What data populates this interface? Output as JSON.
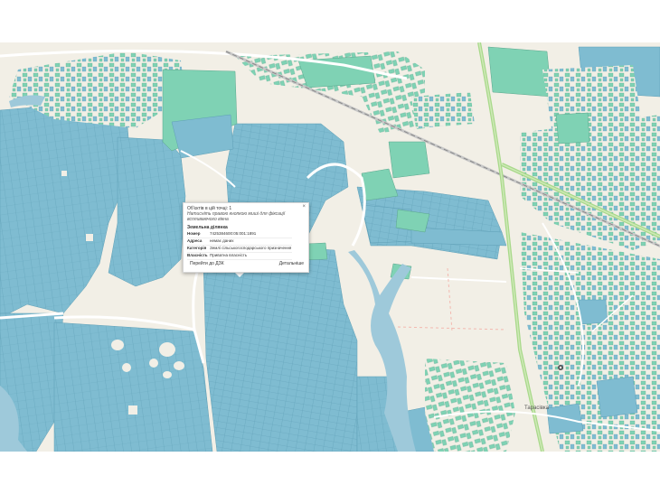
{
  "map": {
    "place_labels": [
      {
        "id": "town",
        "text": "Тарасівка"
      }
    ],
    "marker_icon": "poi-pin-icon",
    "colors": {
      "background": "#f2efe6",
      "parcel": "#7fbcd1",
      "building": "#7fd2b4",
      "road": "#ffffff",
      "railway": "#999999",
      "main_road": "#a8d98a",
      "water": "#9ec9da"
    }
  },
  "popup": {
    "close_glyph": "×",
    "header_line1": "Об'єктів в цій точці: 1",
    "header_line2": "Натисніть правою кнопкою миші для фіксації вспливаючого вікна",
    "section_title": "Земельна ділянка",
    "rows": [
      {
        "key": "Номер",
        "value": "7425384600:05:001:1891"
      },
      {
        "key": "Адреса",
        "value": "немає даних"
      },
      {
        "key": "Категорія",
        "value": "Землі сільськогосподарського призначення"
      },
      {
        "key": "Власність",
        "value": "Приватна власність"
      }
    ],
    "button_dzk": "Перейти до ДЗК",
    "button_details": "Детальніше"
  }
}
